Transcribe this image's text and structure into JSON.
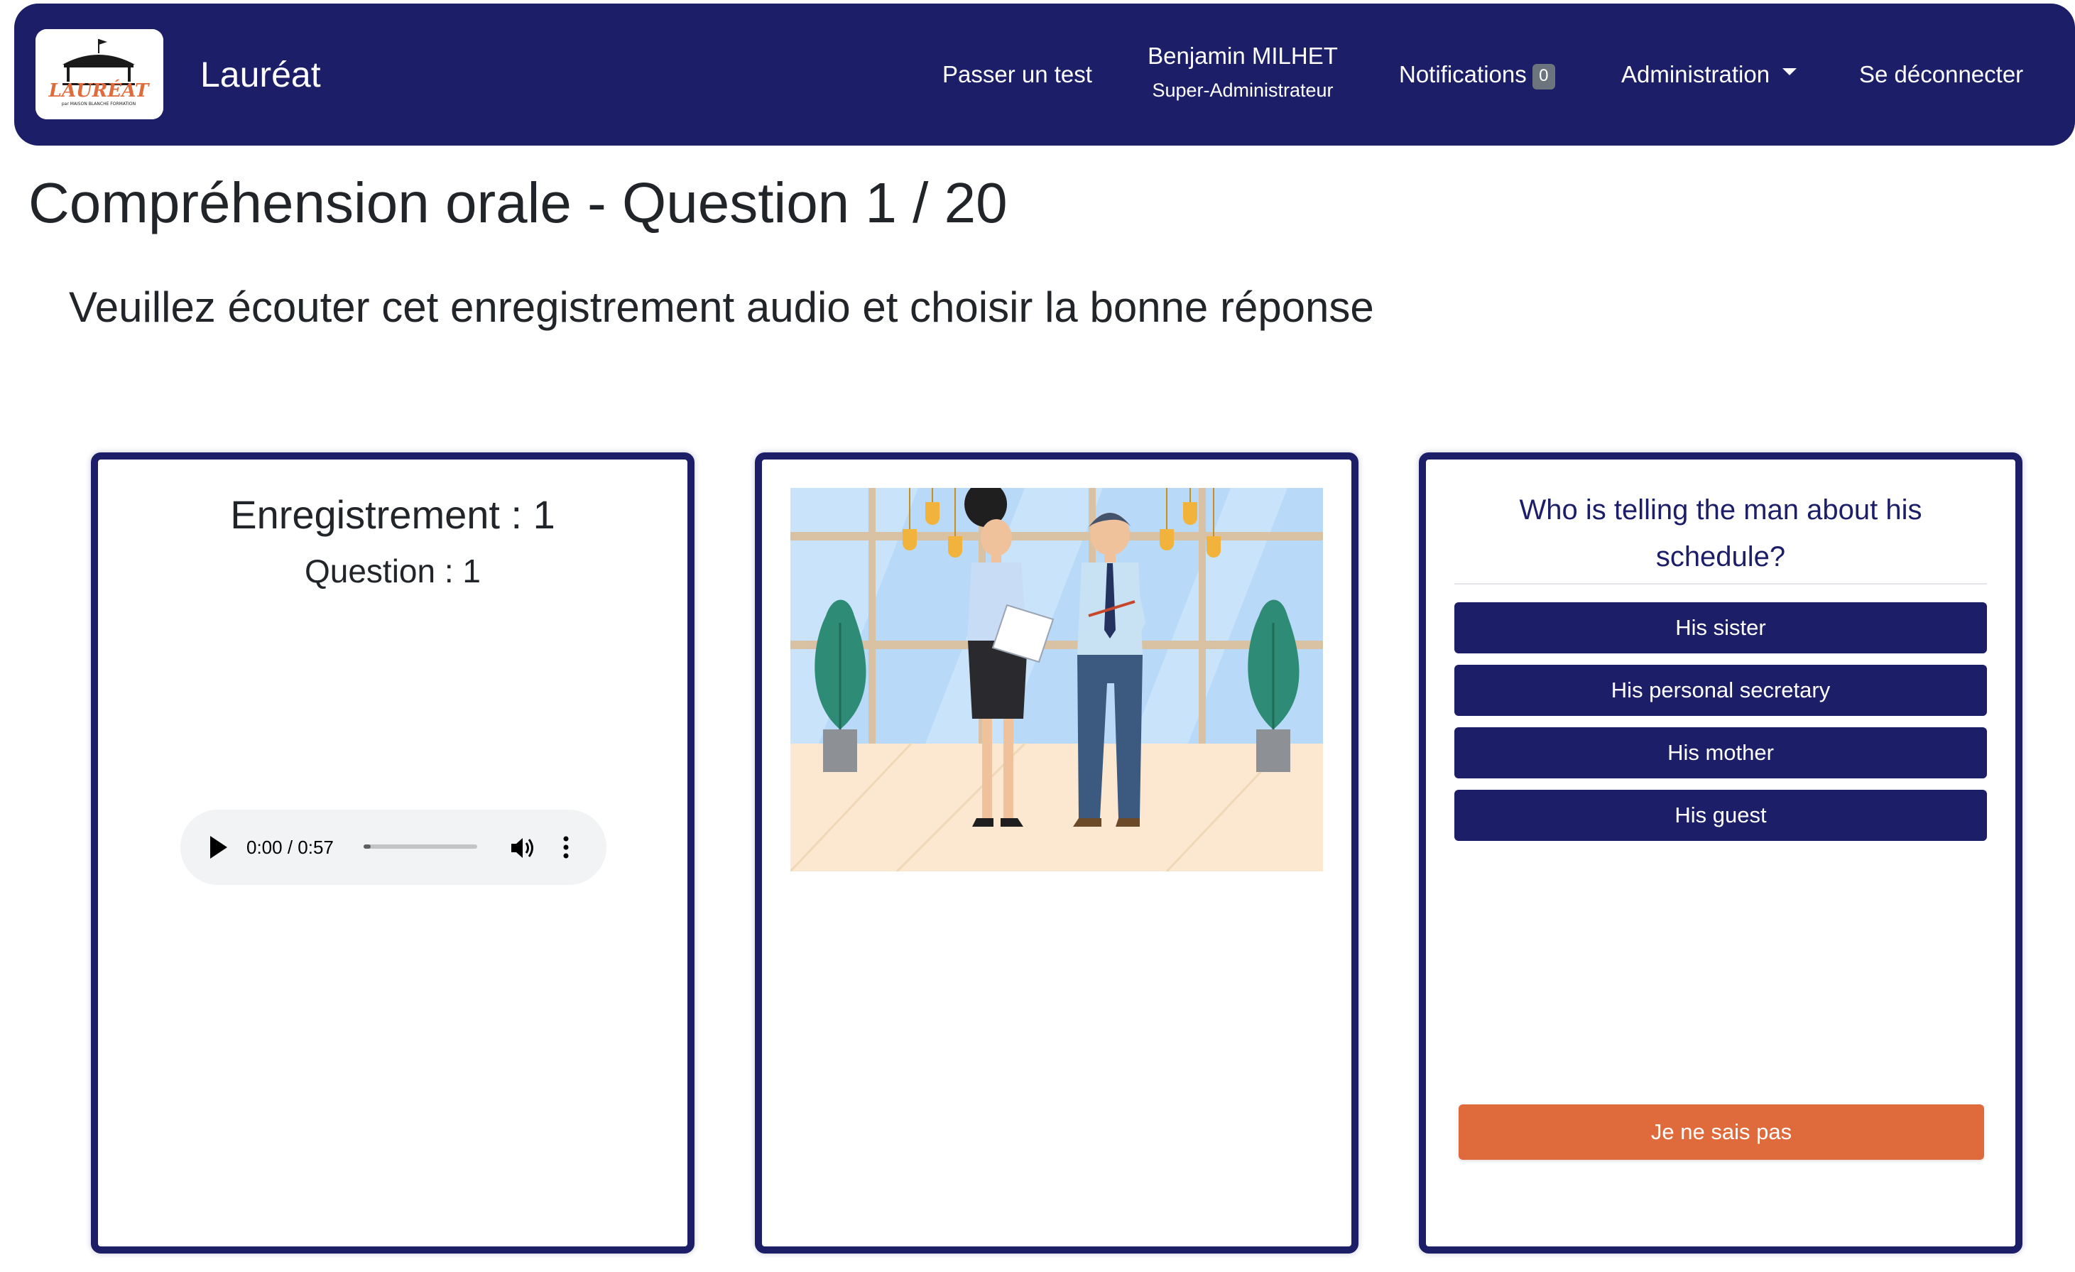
{
  "navbar": {
    "logo": {
      "icon": "laureat-logo",
      "text": "LAURÉAT",
      "tagline": "par MAISON BLANCHE FORMATION"
    },
    "brand": "Lauréat",
    "take_test": "Passer un test",
    "user": {
      "name": "Benjamin MILHET",
      "role": "Super-Administrateur"
    },
    "notifications": {
      "label": "Notifications",
      "count": "0"
    },
    "admin": {
      "label": "Administration",
      "icon": "caret-down-icon"
    },
    "logout": "Se déconnecter"
  },
  "page": {
    "title": "Compréhension orale - Question 1 / 20",
    "instruction": "Veuillez écouter cet enregistrement audio et choisir la bonne réponse"
  },
  "audio_card": {
    "recording": "Enregistrement : 1",
    "question": "Question : 1",
    "player": {
      "time": "0:00 / 0:57",
      "progress_fraction": 0.05
    }
  },
  "image_card": {
    "illustration": "office-conversation-illustration"
  },
  "question_card": {
    "question": "Who is telling the man about his schedule?",
    "answers": [
      "His sister",
      "His personal secretary",
      "His mother",
      "His guest"
    ],
    "dont_know": "Je ne sais pas"
  },
  "colors": {
    "navy": "#1c1e68",
    "orange": "#df6b3c",
    "badge_gray": "#6c757d",
    "player_bg": "#f1f3f4"
  }
}
